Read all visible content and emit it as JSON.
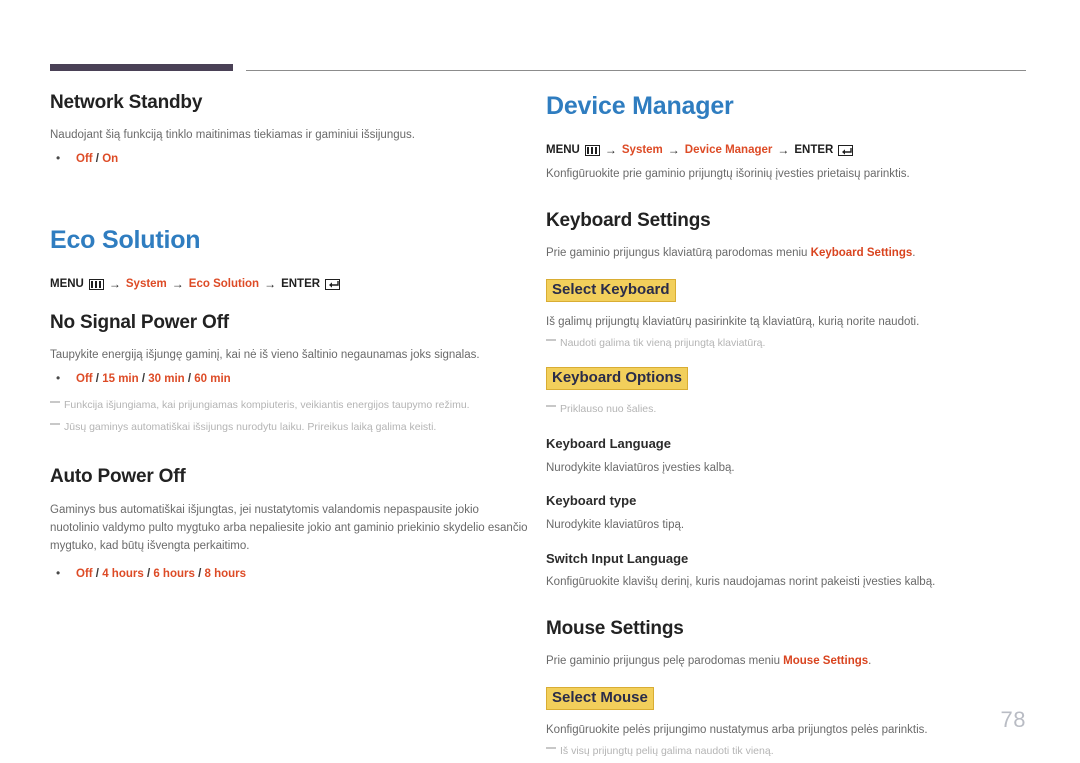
{
  "document": {
    "page_number": "78",
    "accent_red": "#dd4b26",
    "accent_blue": "#2f7dc0",
    "highlight_yellow": "#f2cf5b",
    "rule_purple": "#4a4156"
  },
  "icons": {
    "menu": "menu-icon",
    "enter": "enter-key-icon",
    "bullet": "bullet-dot"
  },
  "left_column": {
    "network_standby": {
      "heading": "Network Standby",
      "description": "Naudojant šią funkciją tinklo maitinimas tiekiamas ir gaminiui išsijungus.",
      "options": [
        "Off",
        "On"
      ]
    },
    "eco_solution": {
      "heading": "Eco Solution",
      "breadcrumb": {
        "menu_label": "MENU",
        "step1": "System",
        "step2": "Eco Solution",
        "enter_label": "ENTER",
        "arrow": "→"
      },
      "no_signal_power_off": {
        "heading": "No Signal Power Off",
        "description": "Taupykite energiją išjungę gaminį, kai nė iš vieno šaltinio negaunamas joks signalas.",
        "options": [
          "Off",
          "15 min",
          "30 min",
          "60 min"
        ],
        "notes": [
          "Funkcija išjungiama, kai prijungiamas kompiuteris, veikiantis energijos taupymo režimu.",
          "Jūsų gaminys automatiškai išsijungs nurodytu laiku. Prireikus laiką galima keisti."
        ]
      },
      "auto_power_off": {
        "heading": "Auto Power Off",
        "description": "Gaminys bus automatiškai išjungtas, jei nustatytomis valandomis nepaspausite jokio nuotolinio valdymo pulto mygtuko arba nepaliesite jokio ant gaminio priekinio skydelio esančio mygtuko, kad būtų išvengta perkaitimo.",
        "options": [
          "Off",
          "4 hours",
          "6 hours",
          "8 hours"
        ]
      }
    }
  },
  "right_column": {
    "device_manager": {
      "heading": "Device Manager",
      "breadcrumb": {
        "menu_label": "MENU",
        "step1": "System",
        "step2": "Device Manager",
        "enter_label": "ENTER",
        "arrow": "→"
      },
      "description": "Konfigūruokite prie gaminio prijungtų išorinių įvesties prietaisų parinktis."
    },
    "keyboard_settings": {
      "heading": "Keyboard Settings",
      "description_prefix": "Prie gaminio prijungus klaviatūrą parodomas meniu ",
      "description_link": "Keyboard Settings",
      "description_suffix": ".",
      "select_keyboard": {
        "heading": "Select Keyboard",
        "description": "Iš galimų prijungtų klaviatūrų pasirinkite tą klaviatūrą, kurią norite naudoti.",
        "note": "Naudoti galima tik vieną prijungtą klaviatūrą."
      },
      "keyboard_options": {
        "heading": "Keyboard Options",
        "note": "Priklauso nuo šalies."
      },
      "keyboard_language": {
        "heading": "Keyboard Language",
        "description": "Nurodykite klaviatūros įvesties kalbą."
      },
      "keyboard_type": {
        "heading": "Keyboard type",
        "description": "Nurodykite klaviatūros tipą."
      },
      "switch_input_language": {
        "heading": "Switch Input Language",
        "description": "Konfigūruokite klavišų derinį, kuris naudojamas norint pakeisti įvesties kalbą."
      }
    },
    "mouse_settings": {
      "heading": "Mouse Settings",
      "description_prefix": "Prie gaminio prijungus pelę parodomas meniu ",
      "description_link": "Mouse Settings",
      "description_suffix": ".",
      "select_mouse": {
        "heading": "Select Mouse",
        "description": "Konfigūruokite pelės prijungimo nustatymus arba prijungtos pelės parinktis.",
        "note": "Iš visų prijungtų pelių galima naudoti tik vieną."
      }
    }
  }
}
